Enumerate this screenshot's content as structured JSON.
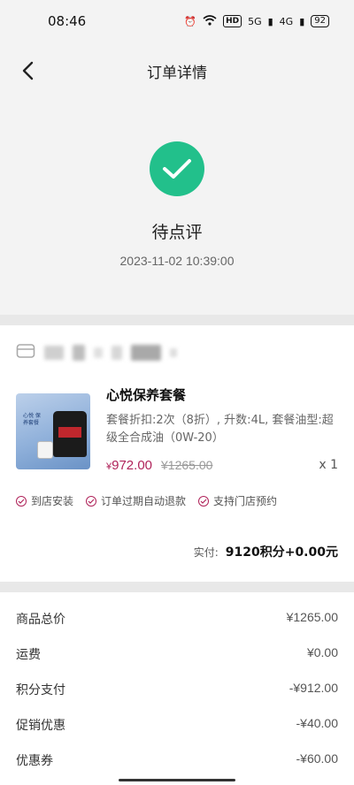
{
  "status_bar": {
    "time": "08:46",
    "hd": "HD",
    "net1": "5G",
    "net2": "4G",
    "battery": "92"
  },
  "nav": {
    "title": "订单详情"
  },
  "order_status": {
    "label": "待点评",
    "time": "2023-11-02 10:39:00",
    "color": "#22c08b"
  },
  "product": {
    "name": "心悦保养套餐",
    "desc": "套餐折扣:2次（8折）, 升数:4L, 套餐油型:超级全合成油（0W-20）",
    "currency": "¥",
    "price": "972.00",
    "old_price": "¥1265.00",
    "qty": "x 1",
    "img_label": "心悦 保养套餐",
    "accent_color": "#b0235a"
  },
  "tags": [
    "到店安装",
    "订单过期自动退款",
    "支持门店预约"
  ],
  "total": {
    "label": "实付:",
    "value": "9120积分+0.00元"
  },
  "summary": [
    {
      "label": "商品总价",
      "amount": "¥1265.00"
    },
    {
      "label": "运费",
      "amount": "¥0.00"
    },
    {
      "label": "积分支付",
      "amount": "-¥912.00"
    },
    {
      "label": "促销优惠",
      "amount": "-¥40.00"
    },
    {
      "label": "优惠券",
      "amount": "-¥60.00"
    }
  ]
}
